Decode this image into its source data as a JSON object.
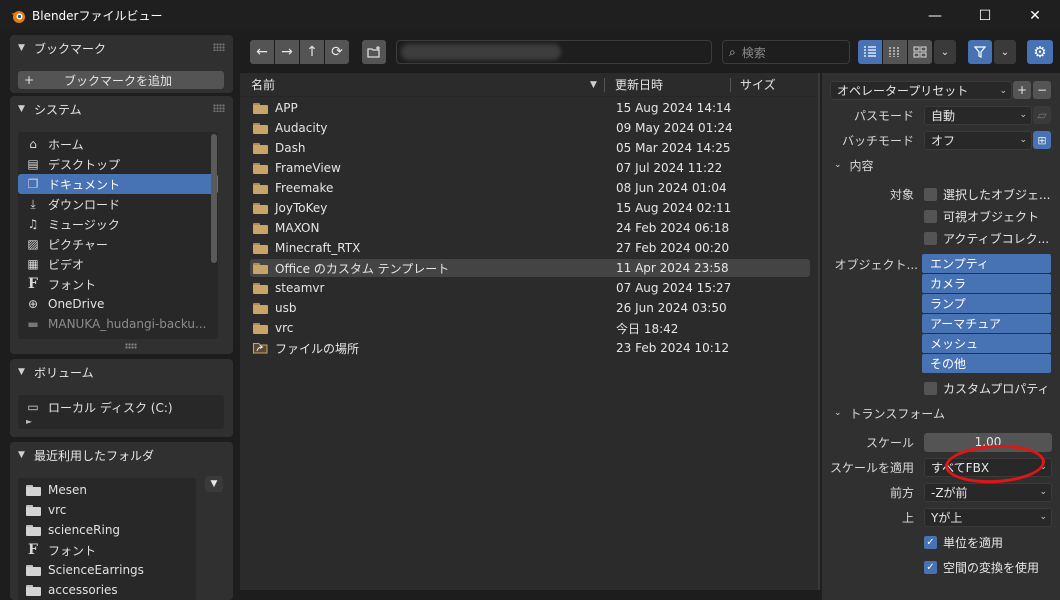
{
  "window": {
    "title": "Blenderファイルビュー",
    "controls": {
      "minimize": "—",
      "maximize": "☐",
      "close": "✕"
    }
  },
  "sidebar": {
    "bookmarks": {
      "header": "ブックマーク",
      "add_button": "ブックマークを追加"
    },
    "system": {
      "header": "システム",
      "items": [
        {
          "label": "ホーム",
          "icon": "home-icon"
        },
        {
          "label": "デスクトップ",
          "icon": "desktop-icon"
        },
        {
          "label": "ドキュメント",
          "icon": "documents-icon",
          "selected": true
        },
        {
          "label": "ダウンロード",
          "icon": "download-icon"
        },
        {
          "label": "ミュージック",
          "icon": "music-icon"
        },
        {
          "label": "ピクチャー",
          "icon": "pictures-icon"
        },
        {
          "label": "ビデオ",
          "icon": "video-icon"
        },
        {
          "label": "フォント",
          "icon": "font-icon"
        },
        {
          "label": "OneDrive",
          "icon": "globe-icon"
        },
        {
          "label": "MANUKA_hudangi-backu...",
          "icon": "drive-icon",
          "dim": true
        }
      ]
    },
    "volumes": {
      "header": "ボリューム",
      "items": [
        {
          "label": "ローカル ディスク (C:)",
          "icon": "disk-icon"
        }
      ]
    },
    "recent": {
      "header": "最近利用したフォルダ",
      "items": [
        {
          "label": "Mesen",
          "icon": "folder-icon"
        },
        {
          "label": "vrc",
          "icon": "folder-icon"
        },
        {
          "label": "scienceRing",
          "icon": "folder-icon"
        },
        {
          "label": "フォント",
          "icon": "font-icon"
        },
        {
          "label": "ScienceEarrings",
          "icon": "folder-icon"
        },
        {
          "label": "accessories",
          "icon": "folder-icon"
        }
      ]
    }
  },
  "toolbar": {
    "back": "←",
    "forward": "→",
    "parent": "↑",
    "refresh": "⟳",
    "search_placeholder": "検索"
  },
  "file_list": {
    "columns": {
      "name": "名前",
      "date": "更新日時",
      "size": "サイズ"
    },
    "rows": [
      {
        "name": "APP",
        "date": "15 Aug 2024 14:14",
        "icon": "folder-icon"
      },
      {
        "name": "Audacity",
        "date": "09 May 2024 01:24",
        "icon": "folder-icon"
      },
      {
        "name": "Dash",
        "date": "05 Mar 2024 14:25",
        "icon": "folder-icon"
      },
      {
        "name": "FrameView",
        "date": "07 Jul 2024 11:22",
        "icon": "folder-icon"
      },
      {
        "name": "Freemake",
        "date": "08 Jun 2024 01:04",
        "icon": "folder-icon"
      },
      {
        "name": "JoyToKey",
        "date": "15 Aug 2024 02:11",
        "icon": "folder-icon"
      },
      {
        "name": "MAXON",
        "date": "24 Feb 2024 06:18",
        "icon": "folder-icon"
      },
      {
        "name": "Minecraft_RTX",
        "date": "27 Feb 2024 00:20",
        "icon": "folder-icon"
      },
      {
        "name": "Office のカスタム テンプレート",
        "date": "11 Apr 2024 23:58",
        "icon": "folder-icon",
        "highlight": true
      },
      {
        "name": "steamvr",
        "date": "07 Aug 2024 15:27",
        "icon": "folder-icon"
      },
      {
        "name": "usb",
        "date": "26 Jun 2024 03:50",
        "icon": "folder-icon"
      },
      {
        "name": "vrc",
        "date": "今日 18:42",
        "icon": "folder-icon"
      },
      {
        "name": "ファイルの場所",
        "date": "23 Feb 2024 10:12",
        "icon": "shortcut-folder-icon"
      }
    ]
  },
  "properties": {
    "operator_preset": "オペレータープリセット",
    "path_mode": {
      "label": "パスモード",
      "value": "自動"
    },
    "batch_mode": {
      "label": "バッチモード",
      "value": "オフ"
    },
    "include": {
      "header": "内容",
      "target_label": "対象",
      "checkboxes": [
        {
          "label": "選択したオブジェ...",
          "checked": false
        },
        {
          "label": "可視オブジェクト",
          "checked": false
        },
        {
          "label": "アクティブコレク...",
          "checked": false
        }
      ],
      "object_types_label": "オブジェクト...",
      "object_types": [
        "エンプティ",
        "カメラ",
        "ランプ",
        "アーマチュア",
        "メッシュ",
        "その他"
      ],
      "custom_props": {
        "label": "カスタムプロパティ",
        "checked": false
      }
    },
    "transform": {
      "header": "トランスフォーム",
      "scale": {
        "label": "スケール",
        "value": "1.00"
      },
      "apply_scale": {
        "label": "スケールを適用",
        "value": "すべてFBX"
      },
      "forward": {
        "label": "前方",
        "value": "-Zが前"
      },
      "up": {
        "label": "上",
        "value": "Yが上"
      },
      "apply_unit": {
        "label": "単位を適用",
        "checked": true
      },
      "space_transform": {
        "label": "空間の変換を使用",
        "checked": true
      }
    }
  }
}
